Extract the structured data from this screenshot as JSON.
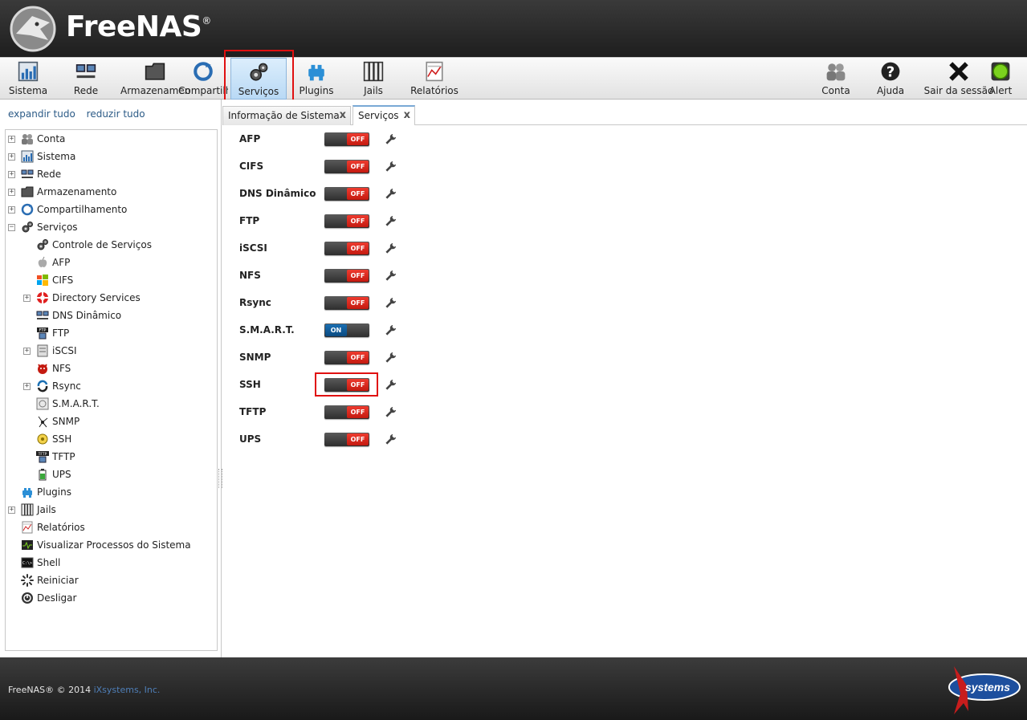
{
  "header": {
    "logo_text": "FreeNAS",
    "registered": "®"
  },
  "toolbar": {
    "left": [
      {
        "id": "sistema",
        "label": "Sistema",
        "icon": "chart-icon"
      },
      {
        "id": "rede",
        "label": "Rede",
        "icon": "network-icon"
      },
      {
        "id": "armazenamento",
        "label": "Armazenamento",
        "icon": "folder-icon"
      },
      {
        "id": "compartilhamento",
        "label": "Compartilhamento",
        "icon": "share-icon"
      },
      {
        "id": "servicos",
        "label": "Serviços",
        "icon": "gears-icon",
        "active": true
      },
      {
        "id": "plugins",
        "label": "Plugins",
        "icon": "plugin-icon"
      },
      {
        "id": "jails",
        "label": "Jails",
        "icon": "jail-icon"
      },
      {
        "id": "relatorios",
        "label": "Relatórios",
        "icon": "report-icon"
      }
    ],
    "right": [
      {
        "id": "conta",
        "label": "Conta",
        "icon": "users-icon"
      },
      {
        "id": "ajuda",
        "label": "Ajuda",
        "icon": "help-icon"
      },
      {
        "id": "sair",
        "label": "Sair da sessão",
        "icon": "logout-x-icon"
      },
      {
        "id": "alert",
        "label": "Alert",
        "icon": "alert-light-icon"
      }
    ]
  },
  "sidebar": {
    "expand_all": "expandir tudo",
    "collapse_all": "reduzir tudo",
    "tree": [
      {
        "label": "Conta",
        "level": 0,
        "toggle": "+",
        "icon": "users-icon"
      },
      {
        "label": "Sistema",
        "level": 0,
        "toggle": "+",
        "icon": "chart-icon"
      },
      {
        "label": "Rede",
        "level": 0,
        "toggle": "+",
        "icon": "network-icon"
      },
      {
        "label": "Armazenamento",
        "level": 0,
        "toggle": "+",
        "icon": "folder-icon"
      },
      {
        "label": "Compartilhamento",
        "level": 0,
        "toggle": "+",
        "icon": "share-icon"
      },
      {
        "label": "Serviços",
        "level": 0,
        "toggle": "−",
        "icon": "gears-icon"
      },
      {
        "label": "Controle de Serviços",
        "level": 1,
        "toggle": "",
        "icon": "gears-icon"
      },
      {
        "label": "AFP",
        "level": 1,
        "toggle": "",
        "icon": "apple-icon"
      },
      {
        "label": "CIFS",
        "level": 1,
        "toggle": "",
        "icon": "windows-icon"
      },
      {
        "label": "Directory Services",
        "level": 1,
        "toggle": "+",
        "icon": "lifebuoy-icon"
      },
      {
        "label": "DNS Dinâmico",
        "level": 1,
        "toggle": "",
        "icon": "network-icon"
      },
      {
        "label": "FTP",
        "level": 1,
        "toggle": "",
        "icon": "ftp-icon"
      },
      {
        "label": "iSCSI",
        "level": 1,
        "toggle": "+",
        "icon": "disk-icon"
      },
      {
        "label": "NFS",
        "level": 1,
        "toggle": "",
        "icon": "nfs-daemon-icon"
      },
      {
        "label": "Rsync",
        "level": 1,
        "toggle": "+",
        "icon": "sync-icon"
      },
      {
        "label": "S.M.A.R.T.",
        "level": 1,
        "toggle": "",
        "icon": "smart-disk-icon"
      },
      {
        "label": "SNMP",
        "level": 1,
        "toggle": "",
        "icon": "snmp-icon"
      },
      {
        "label": "SSH",
        "level": 1,
        "toggle": "",
        "icon": "ssh-key-icon"
      },
      {
        "label": "TFTP",
        "level": 1,
        "toggle": "",
        "icon": "tftp-icon"
      },
      {
        "label": "UPS",
        "level": 1,
        "toggle": "",
        "icon": "battery-icon"
      },
      {
        "label": "Plugins",
        "level": 0,
        "toggle": "",
        "icon": "plugin-icon"
      },
      {
        "label": "Jails",
        "level": 0,
        "toggle": "+",
        "icon": "jail-icon"
      },
      {
        "label": "Relatórios",
        "level": 0,
        "toggle": "",
        "icon": "report-icon"
      },
      {
        "label": "Visualizar Processos do Sistema",
        "level": 0,
        "toggle": "",
        "icon": "process-monitor-icon"
      },
      {
        "label": "Shell",
        "level": 0,
        "toggle": "",
        "icon": "shell-icon"
      },
      {
        "label": "Reiniciar",
        "level": 0,
        "toggle": "",
        "icon": "reboot-spinner-icon"
      },
      {
        "label": "Desligar",
        "level": 0,
        "toggle": "",
        "icon": "power-icon"
      }
    ]
  },
  "tabs": [
    {
      "label": "Informação de Sistema",
      "close": "x",
      "active": false
    },
    {
      "label": "Serviços",
      "close": "x",
      "active": true
    }
  ],
  "services": [
    {
      "name": "AFP",
      "state": "OFF"
    },
    {
      "name": "CIFS",
      "state": "OFF"
    },
    {
      "name": "DNS Dinâmico",
      "state": "OFF"
    },
    {
      "name": "FTP",
      "state": "OFF"
    },
    {
      "name": "iSCSI",
      "state": "OFF"
    },
    {
      "name": "NFS",
      "state": "OFF"
    },
    {
      "name": "Rsync",
      "state": "OFF"
    },
    {
      "name": "S.M.A.R.T.",
      "state": "ON"
    },
    {
      "name": "SNMP",
      "state": "OFF"
    },
    {
      "name": "SSH",
      "state": "OFF",
      "highlighted": true
    },
    {
      "name": "TFTP",
      "state": "OFF"
    },
    {
      "name": "UPS",
      "state": "OFF"
    }
  ],
  "footer": {
    "copyright": "FreeNAS® © 2014",
    "company": "iXsystems, Inc.",
    "logo_text": "systems"
  },
  "colors": {
    "off": "#d9231a",
    "on": "#0f5a97",
    "highlight": "#e01010",
    "link": "#2b5a86"
  }
}
